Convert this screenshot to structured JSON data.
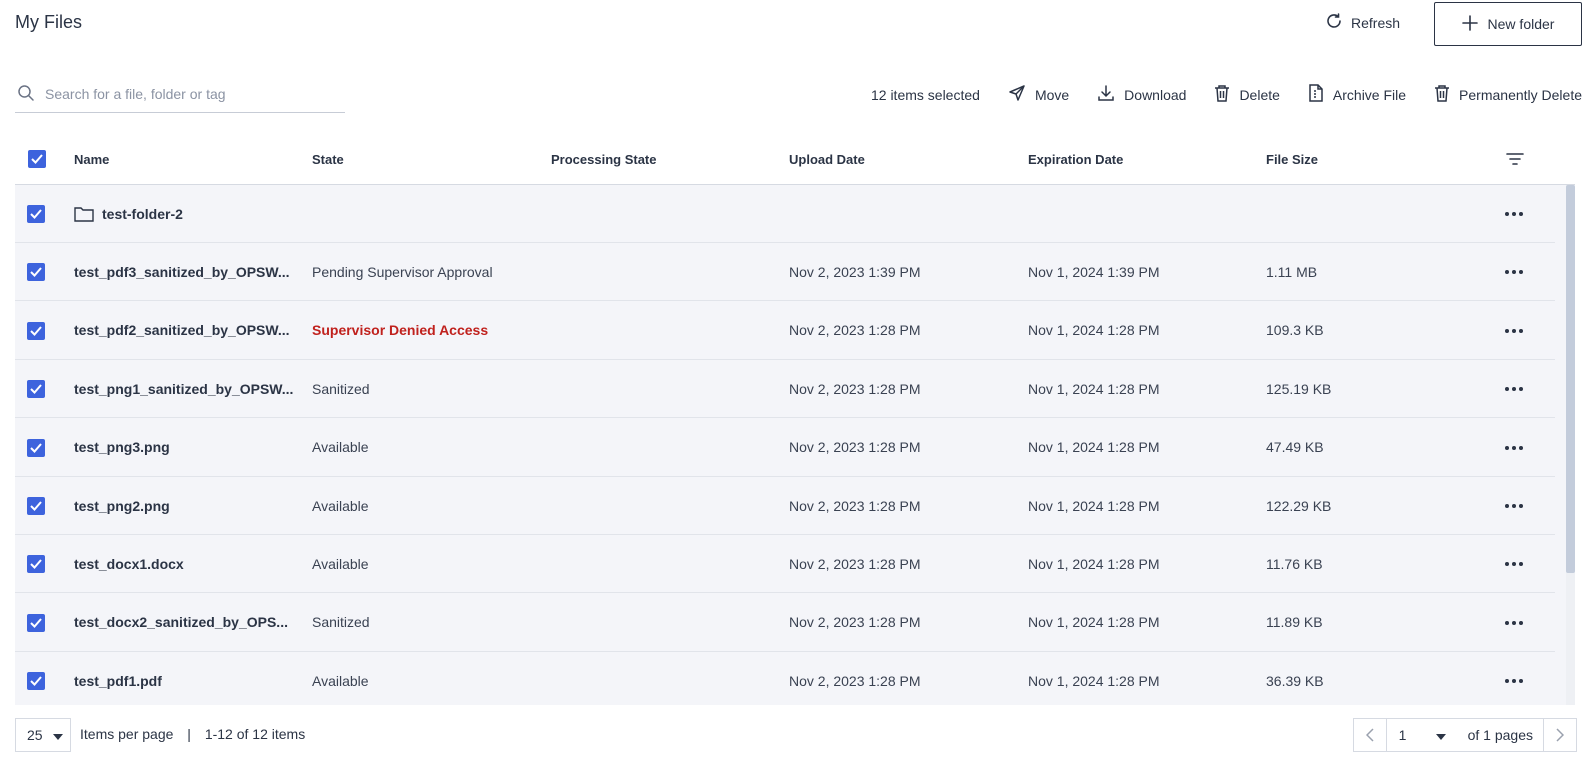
{
  "header": {
    "title": "My Files",
    "refresh_label": "Refresh",
    "new_folder_label": "New folder"
  },
  "toolbar": {
    "search_placeholder": "Search for a file, folder or tag",
    "selected_count": "12 items selected",
    "move_label": "Move",
    "download_label": "Download",
    "delete_label": "Delete",
    "archive_label": "Archive File",
    "permanent_delete_label": "Permanently Delete"
  },
  "table": {
    "columns": [
      "Name",
      "State",
      "Processing State",
      "Upload Date",
      "Expiration Date",
      "File Size"
    ],
    "rows": [
      {
        "name": "test-folder-2",
        "is_folder": true,
        "state": "",
        "processing": "",
        "upload": "",
        "expiration": "",
        "size": ""
      },
      {
        "name": "test_pdf3_sanitized_by_OPSW...",
        "is_folder": false,
        "state": "Pending Supervisor Approval",
        "processing": "",
        "upload": "Nov 2, 2023 1:39 PM",
        "expiration": "Nov 1, 2024 1:39 PM",
        "size": "1.11 MB"
      },
      {
        "name": "test_pdf2_sanitized_by_OPSW...",
        "is_folder": false,
        "state": "Supervisor Denied Access",
        "state_status": "denied",
        "processing": "",
        "upload": "Nov 2, 2023 1:28 PM",
        "expiration": "Nov 1, 2024 1:28 PM",
        "size": "109.3 KB"
      },
      {
        "name": "test_png1_sanitized_by_OPSW...",
        "is_folder": false,
        "state": "Sanitized",
        "processing": "",
        "upload": "Nov 2, 2023 1:28 PM",
        "expiration": "Nov 1, 2024 1:28 PM",
        "size": "125.19 KB"
      },
      {
        "name": "test_png3.png",
        "is_folder": false,
        "state": "Available",
        "processing": "",
        "upload": "Nov 2, 2023 1:28 PM",
        "expiration": "Nov 1, 2024 1:28 PM",
        "size": "47.49 KB"
      },
      {
        "name": "test_png2.png",
        "is_folder": false,
        "state": "Available",
        "processing": "",
        "upload": "Nov 2, 2023 1:28 PM",
        "expiration": "Nov 1, 2024 1:28 PM",
        "size": "122.29 KB"
      },
      {
        "name": "test_docx1.docx",
        "is_folder": false,
        "state": "Available",
        "processing": "",
        "upload": "Nov 2, 2023 1:28 PM",
        "expiration": "Nov 1, 2024 1:28 PM",
        "size": "11.76 KB"
      },
      {
        "name": "test_docx2_sanitized_by_OPS...",
        "is_folder": false,
        "state": "Sanitized",
        "processing": "",
        "upload": "Nov 2, 2023 1:28 PM",
        "expiration": "Nov 1, 2024 1:28 PM",
        "size": "11.89 KB"
      },
      {
        "name": "test_pdf1.pdf",
        "is_folder": false,
        "state": "Available",
        "processing": "",
        "upload": "Nov 2, 2023 1:28 PM",
        "expiration": "Nov 1, 2024 1:28 PM",
        "size": "36.39 KB"
      }
    ]
  },
  "footer": {
    "per_page_value": "25",
    "per_page_label": "Items per page",
    "range_label": "1-12 of 12 items",
    "page_value": "1",
    "of_pages": "of 1 pages"
  },
  "colors": {
    "accent": "#3d63dd",
    "denied": "#c0211d",
    "text": "#2b3445",
    "row_bg": "#f4f5f9"
  },
  "icons": {
    "refresh": "refresh-icon",
    "new_folder": "plus-icon",
    "search": "search-icon",
    "move": "send-icon",
    "download": "download-icon",
    "delete": "trash-icon",
    "archive": "archive-file-icon",
    "permanent_delete": "trash-icon",
    "filter": "filter-icon",
    "folder": "folder-icon",
    "more": "more-horizontal-icon"
  }
}
